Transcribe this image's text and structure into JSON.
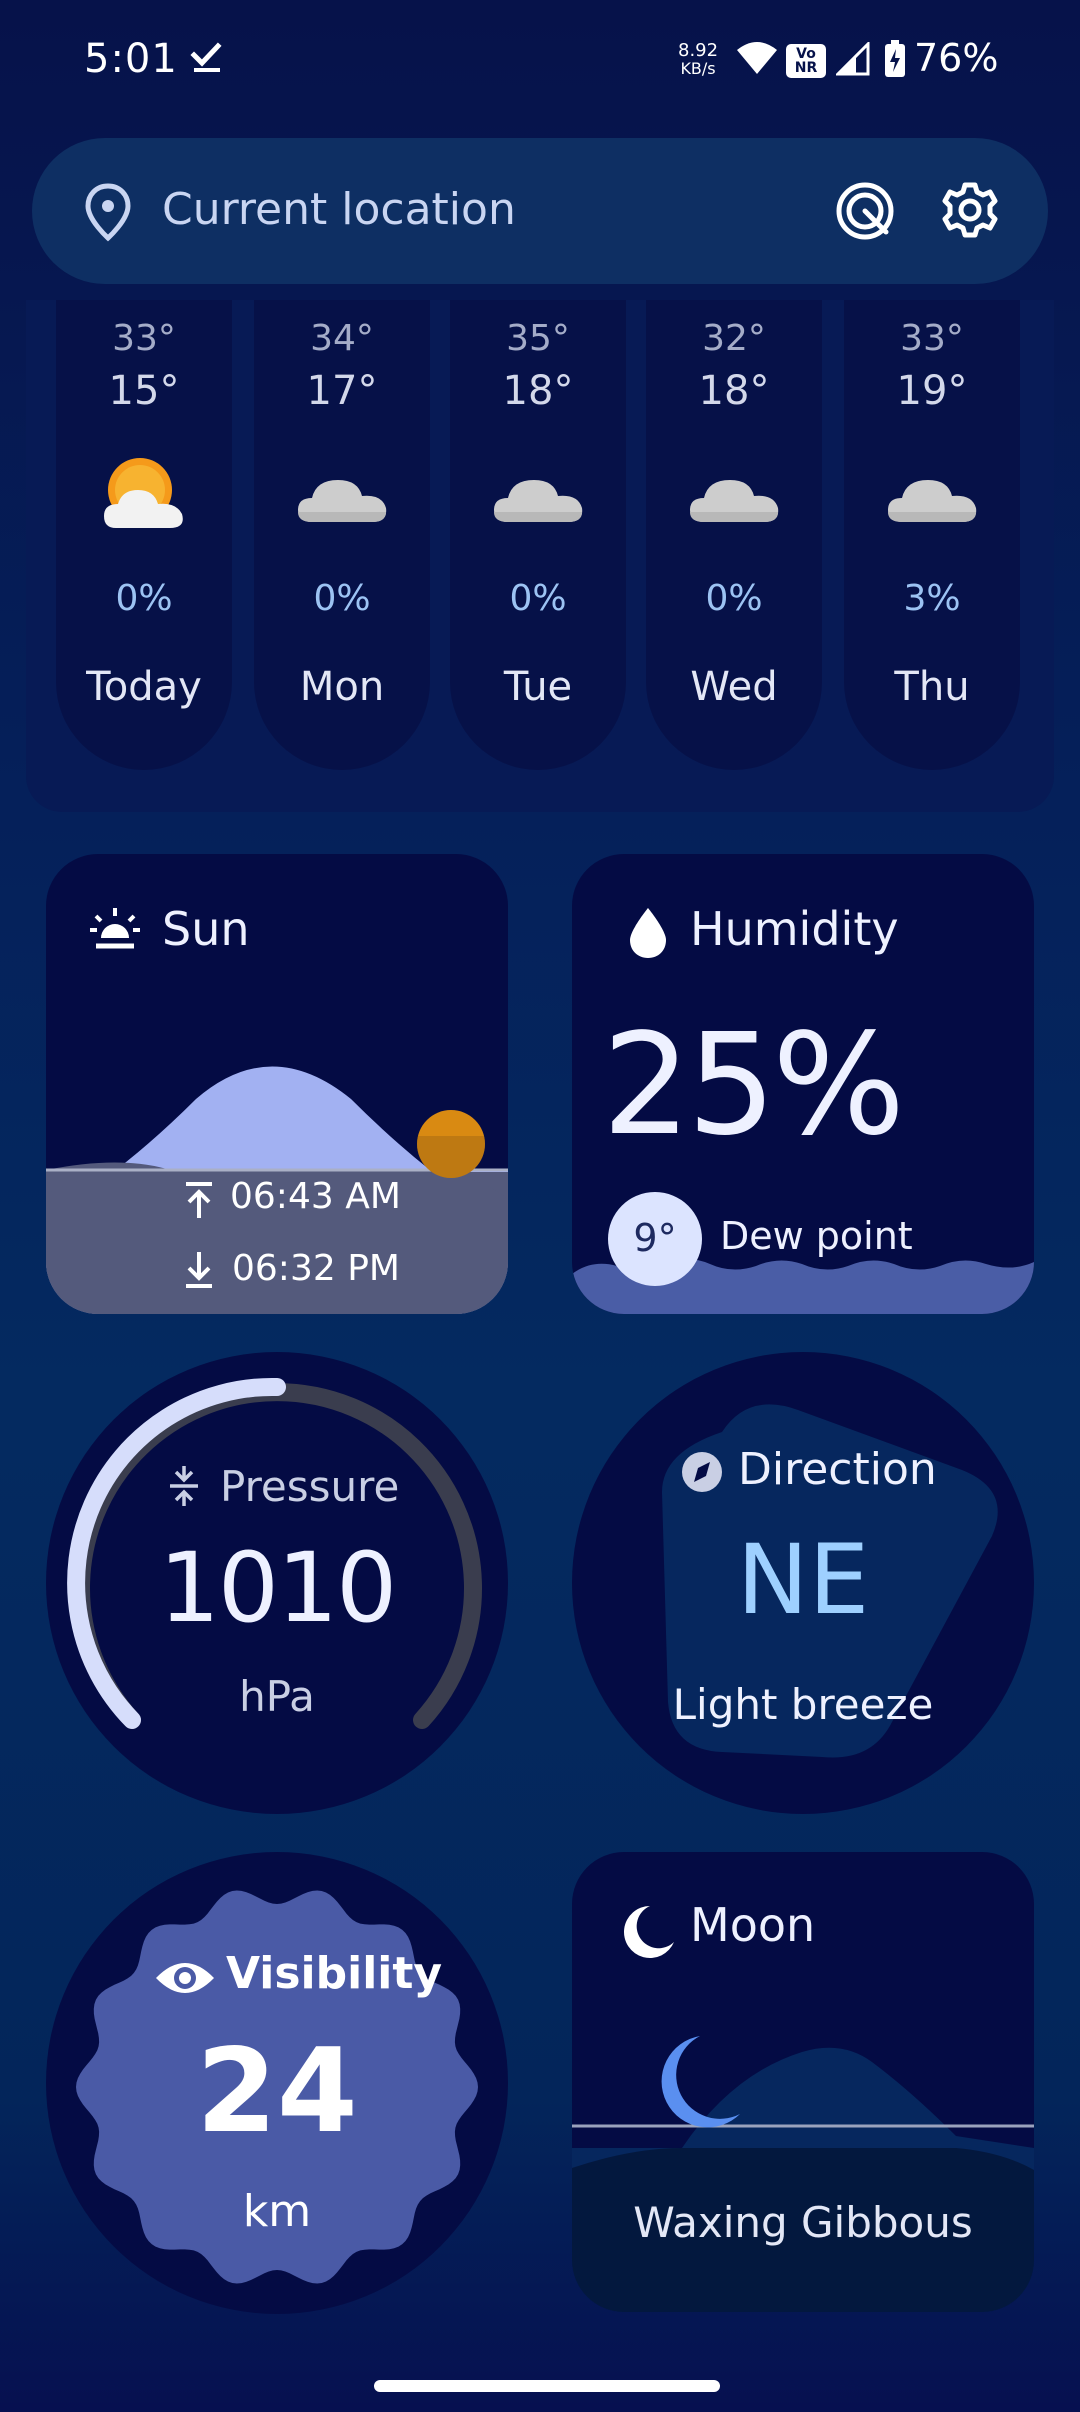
{
  "status_bar": {
    "time": "5:01",
    "speed_value": "8.92",
    "speed_unit": "KB/s",
    "vonr_top": "Vo",
    "vonr_bottom": "NR",
    "battery": "76%"
  },
  "search": {
    "placeholder": "Current location"
  },
  "forecast": [
    {
      "high": "33°",
      "low": "15°",
      "precip": "0%",
      "day": "Today",
      "icon": "partly-sunny-icon"
    },
    {
      "high": "34°",
      "low": "17°",
      "precip": "0%",
      "day": "Mon",
      "icon": "cloud-icon"
    },
    {
      "high": "35°",
      "low": "18°",
      "precip": "0%",
      "day": "Tue",
      "icon": "cloud-icon"
    },
    {
      "high": "32°",
      "low": "18°",
      "precip": "0%",
      "day": "Wed",
      "icon": "cloud-icon"
    },
    {
      "high": "33°",
      "low": "19°",
      "precip": "3%",
      "day": "Thu",
      "icon": "cloud-icon"
    }
  ],
  "sun": {
    "title": "Sun",
    "sunrise": "06:43 AM",
    "sunset": "06:32 PM"
  },
  "humidity": {
    "title": "Humidity",
    "value": "25%",
    "dew_point": "9°",
    "dew_label": "Dew point"
  },
  "pressure": {
    "title": "Pressure",
    "value": "1010",
    "unit": "hPa"
  },
  "direction": {
    "title": "Direction",
    "value": "NE",
    "description": "Light breeze"
  },
  "visibility": {
    "title": "Visibility",
    "value": "24",
    "unit": "km"
  },
  "moon": {
    "title": "Moon",
    "phase": "Waxing Gibbous"
  },
  "colors": {
    "background": "#06124a",
    "card": "#040b44",
    "accent": "#a2b6f7",
    "sun_orb": "#d98a12",
    "direction_text": "#9ed0ff"
  }
}
